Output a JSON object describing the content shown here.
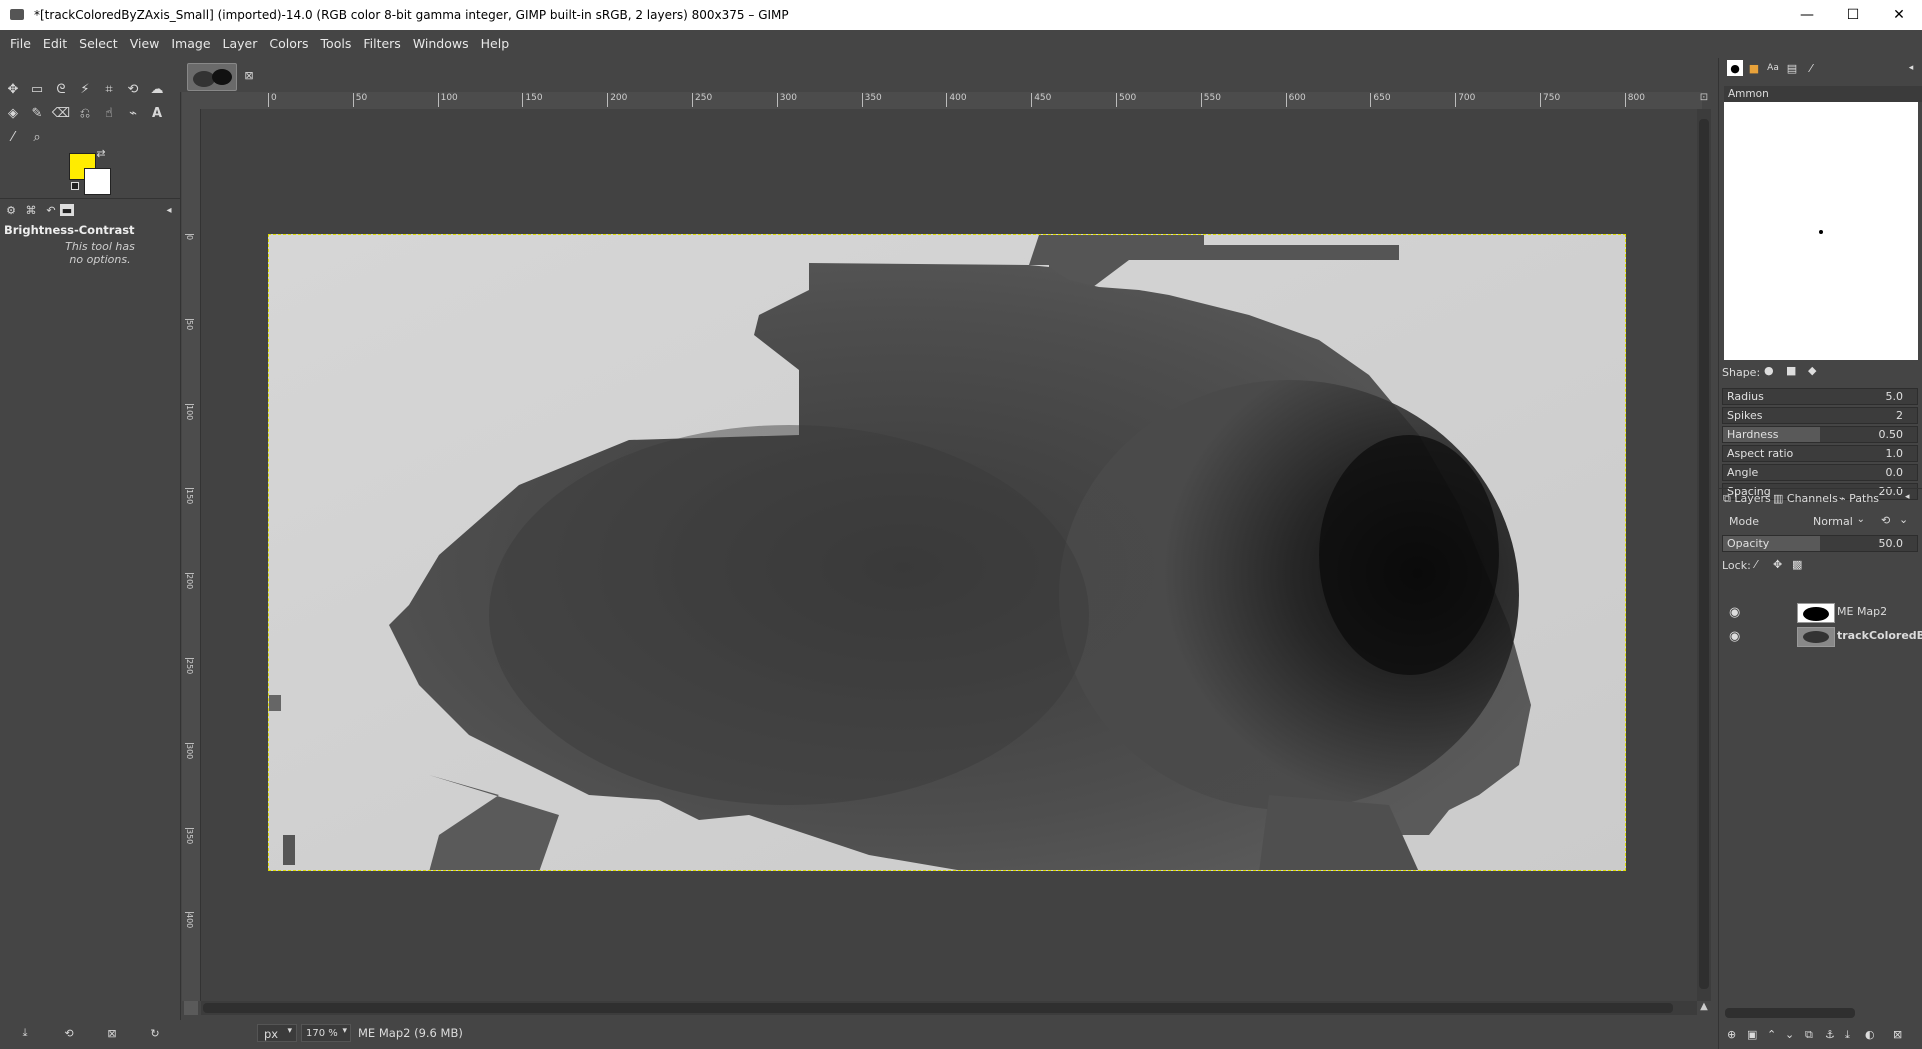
{
  "window": {
    "title": "*[trackColoredByZAxis_Small] (imported)-14.0 (RGB color 8-bit gamma integer, GIMP built-in sRGB, 2 layers) 800x375 – GIMP",
    "minimize": "—",
    "maximize": "☐",
    "close": "✕"
  },
  "menubar": [
    "File",
    "Edit",
    "Select",
    "View",
    "Image",
    "Layer",
    "Colors",
    "Tools",
    "Filters",
    "Windows",
    "Help"
  ],
  "colors": {
    "foreground": "#ffec00",
    "background": "#ffffff",
    "selection_outline": "#dede00"
  },
  "tool_options": {
    "title": "Brightness-Contrast",
    "message_line1": "This tool has",
    "message_line2": "no options."
  },
  "ruler": {
    "horizontal": [
      "0",
      "50",
      "100",
      "150",
      "200",
      "250",
      "300",
      "350",
      "400",
      "450",
      "500",
      "550",
      "600",
      "650",
      "700",
      "750",
      "800"
    ],
    "vertical": [
      "0",
      "50",
      "100",
      "150",
      "200",
      "250",
      "300",
      "350",
      "400"
    ]
  },
  "statusbar": {
    "unit": "px",
    "zoom": "170 %",
    "message": "ME Map2 (9.6 MB)"
  },
  "brushes": {
    "name": "Ammon",
    "shape_label": "Shape:",
    "sliders": [
      {
        "label": "Radius",
        "value": "5.0",
        "level": 0.0
      },
      {
        "label": "Spikes",
        "value": "2",
        "level": 0.0
      },
      {
        "label": "Hardness",
        "value": "0.50",
        "level": 0.5
      },
      {
        "label": "Aspect ratio",
        "value": "1.0",
        "level": 0.0
      },
      {
        "label": "Angle",
        "value": "0.0",
        "level": 0.0
      },
      {
        "label": "Spacing",
        "value": "20.0",
        "level": 0.0
      }
    ]
  },
  "layers_panel": {
    "tabs": [
      "Layers",
      "Channels",
      "Paths"
    ],
    "mode_label": "Mode",
    "mode_value": "Normal",
    "opacity_label": "Opacity",
    "opacity_value": "50.0",
    "opacity_level": 0.5,
    "lock_label": "Lock:",
    "layers": [
      {
        "name": "ME Map2",
        "bold": false
      },
      {
        "name": "trackColoredB",
        "bold": true
      }
    ]
  }
}
